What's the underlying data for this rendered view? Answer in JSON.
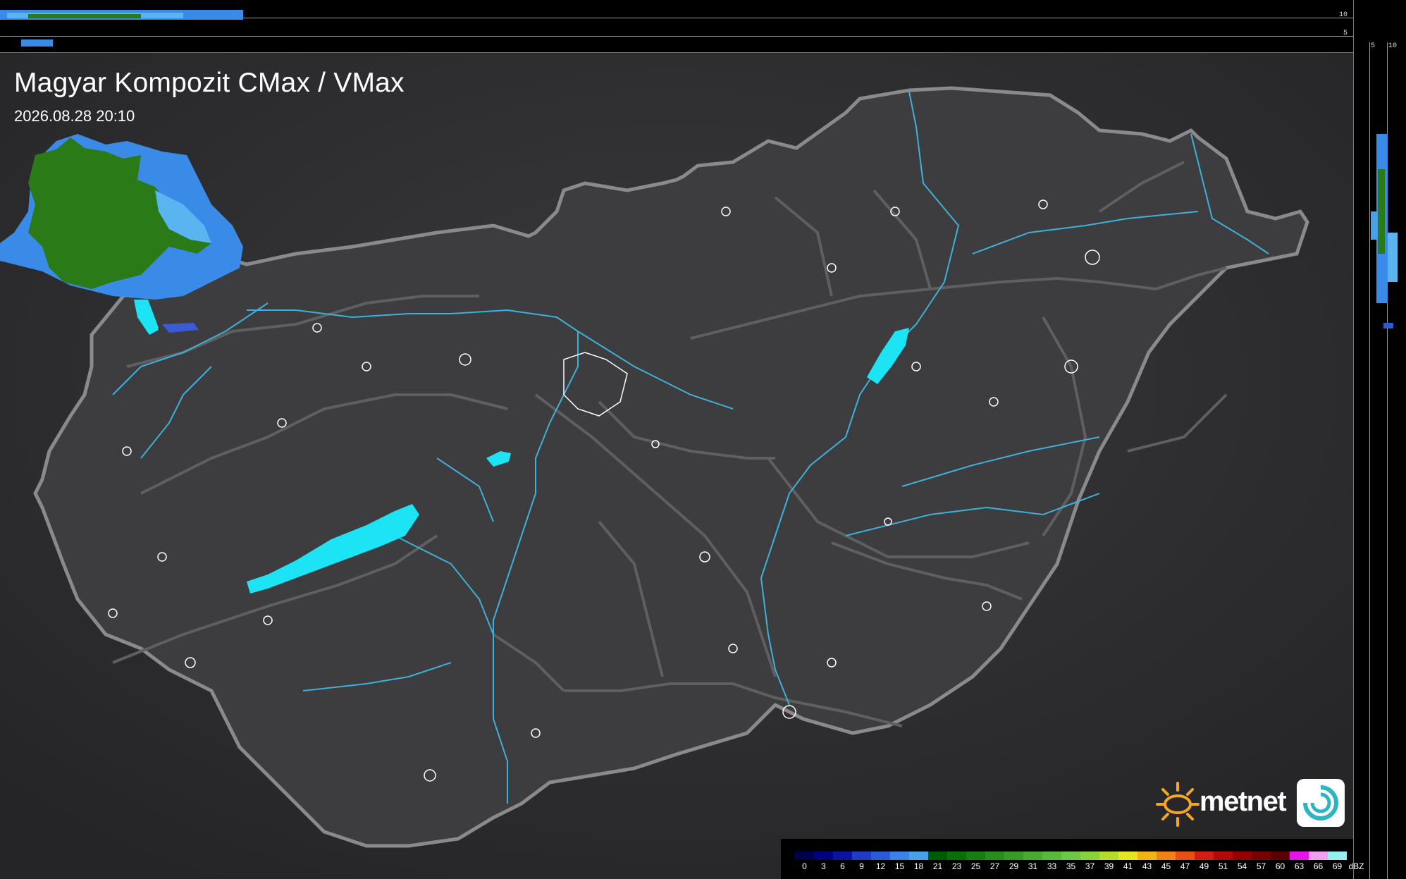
{
  "title": "Magyar Kompozit CMax / VMax",
  "datetime": "2026.08.28 20:10",
  "top_strip_ticks": [
    "10",
    "5"
  ],
  "right_strip_ticks": [
    "5",
    "10"
  ],
  "logo_text": "metnet",
  "legend": {
    "unit": "dBZ",
    "labels": [
      "0",
      "3",
      "6",
      "9",
      "12",
      "15",
      "18",
      "21",
      "23",
      "25",
      "27",
      "29",
      "31",
      "33",
      "35",
      "37",
      "39",
      "41",
      "43",
      "45",
      "47",
      "49",
      "51",
      "54",
      "57",
      "60",
      "63",
      "66",
      "69"
    ],
    "colors": [
      "#00004b",
      "#000080",
      "#0a14a0",
      "#1e3cc8",
      "#2a5ad6",
      "#3c82e6",
      "#4aa0e8",
      "#005a00",
      "#0a6e0a",
      "#1a7d14",
      "#288c1e",
      "#3a9a28",
      "#4ba832",
      "#5ab83c",
      "#6ec846",
      "#88d23c",
      "#b4dc28",
      "#e6e61e",
      "#f0b414",
      "#f08214",
      "#e65014",
      "#d21e14",
      "#b40a0a",
      "#960000",
      "#780000",
      "#5a0000",
      "#e614e6",
      "#f0a0f0",
      "#96f0f0"
    ]
  },
  "colors": {
    "map_background": "#2c2c2e",
    "river": "#3fb0d8",
    "lake": "#1ce4f4",
    "border": "#8a8a8c",
    "precip_green": "#2a7a18",
    "precip_blue": "#3a8ae8"
  }
}
